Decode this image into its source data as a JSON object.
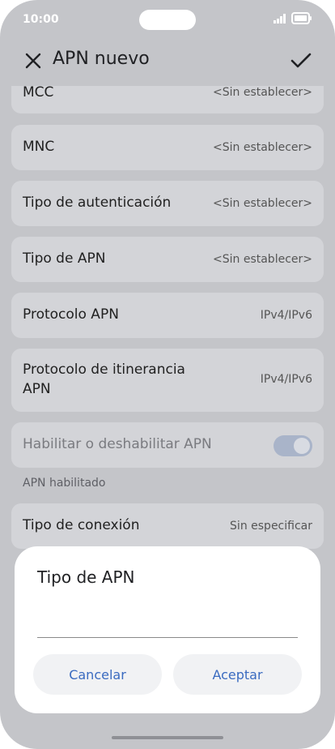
{
  "status_bar": {
    "time": "10:00"
  },
  "header": {
    "title": "APN nuevo"
  },
  "list": {
    "rows": [
      {
        "label": "MCC",
        "value": "<Sin establecer>"
      },
      {
        "label": "MNC",
        "value": "<Sin establecer>"
      },
      {
        "label": "Tipo de autenticación",
        "value": "<Sin establecer>"
      },
      {
        "label": "Tipo de APN",
        "value": "<Sin establecer>"
      },
      {
        "label": "Protocolo APN",
        "value": "IPv4/IPv6"
      },
      {
        "label_line1": "Protocolo de itinerancia",
        "label_line2": "APN",
        "value": "IPv4/IPv6"
      },
      {
        "label": "Habilitar o deshabilitar APN",
        "toggle_on": true
      },
      {
        "label": "Tipo de conexión",
        "value": "Sin especificar"
      }
    ],
    "caption": "APN habilitado"
  },
  "dialog": {
    "title": "Tipo de APN",
    "input_value": "",
    "cancel_label": "Cancelar",
    "accept_label": "Aceptar"
  },
  "colors": {
    "background_dim": "#c4c5c9",
    "row_bg": "#d3d4d8",
    "accent": "#3a6bc0"
  }
}
